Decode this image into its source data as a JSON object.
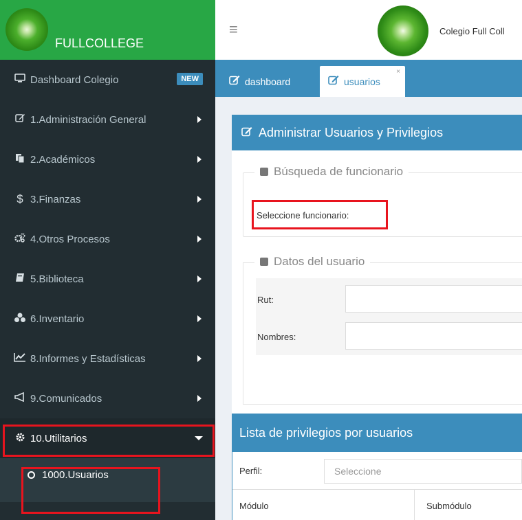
{
  "brand": {
    "name": "FULLCOLLEGE"
  },
  "sidebar": {
    "items": [
      {
        "label": "Dashboard Colegio",
        "icon": "monitor-icon",
        "badge": "NEW"
      },
      {
        "label": "1.Administración General",
        "icon": "edit-icon"
      },
      {
        "label": "2.Académicos",
        "icon": "copy-icon"
      },
      {
        "label": "3.Finanzas",
        "icon": "dollar-icon"
      },
      {
        "label": "4.Otros Procesos",
        "icon": "cogs-icon"
      },
      {
        "label": "5.Biblioteca",
        "icon": "book-icon"
      },
      {
        "label": "6.Inventario",
        "icon": "cubes-icon"
      },
      {
        "label": "8.Informes y Estadísticas",
        "icon": "chart-icon"
      },
      {
        "label": "9.Comunicados",
        "icon": "bullhorn-icon"
      },
      {
        "label": "10.Utilitarios",
        "icon": "gear-icon"
      }
    ],
    "subitem": {
      "label": "1000.Usuarios",
      "icon": "circle-icon"
    }
  },
  "header": {
    "title": "Colegio Full Coll"
  },
  "tabs": [
    {
      "label": "dashboard",
      "icon": "edit-icon"
    },
    {
      "label": "usuarios",
      "icon": "edit-icon",
      "close": "×"
    }
  ],
  "main": {
    "title": "Administrar Usuarios y Privilegios",
    "busqueda": {
      "legend": "Búsqueda de funcionario",
      "field_label": "Seleccione funcionario:"
    },
    "datos": {
      "legend": "Datos del usuario",
      "rut_label": "Rut:",
      "nombres_label": "Nombres:"
    },
    "privilegios": {
      "title": "Lista de privilegios por usuarios",
      "perfil_label": "Perfil:",
      "perfil_placeholder": "Seleccione",
      "col_modulo": "Módulo",
      "col_submodulo": "Submódulo"
    }
  },
  "colors": {
    "brand": "#28a745",
    "sidebar": "#222d32",
    "primary": "#3c8dbc",
    "highlight": "#e8141e"
  }
}
